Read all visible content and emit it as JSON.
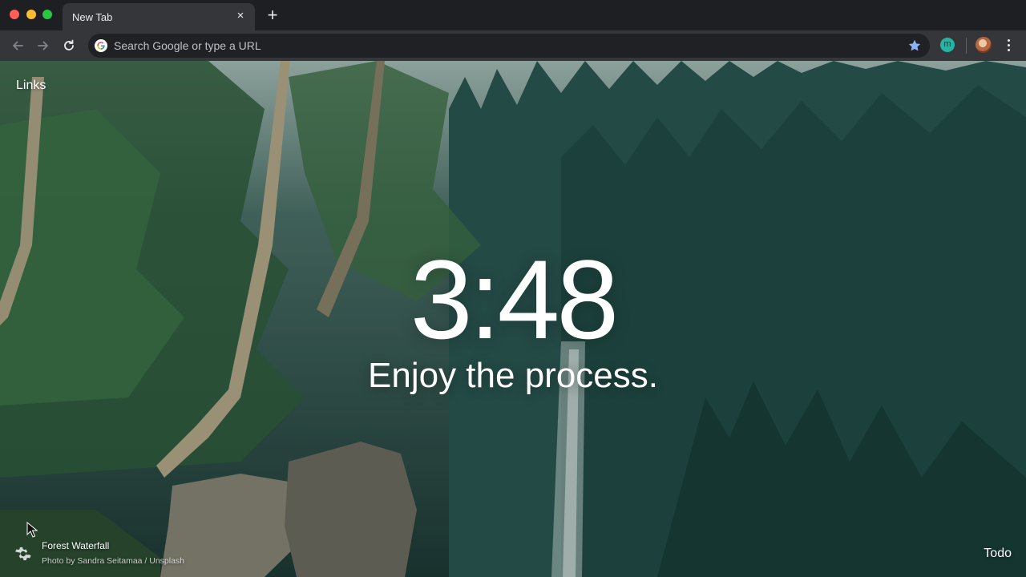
{
  "browser": {
    "tab": {
      "title": "New Tab",
      "close_glyph": "×"
    },
    "new_tab_glyph": "+",
    "omnibox": {
      "placeholder": "Search Google or type a URL"
    },
    "icons": {
      "back": "back-arrow-icon",
      "forward": "forward-arrow-icon",
      "reload": "reload-icon",
      "google": "google-g-icon",
      "bookmark": "bookmark-star-icon",
      "extension": "extension-icon",
      "profile": "profile-avatar",
      "menu": "kebab-menu-icon"
    },
    "extension_letter": "m",
    "colors": {
      "bookmark_star": "#8ab4f8",
      "extension": "#26b3a5"
    }
  },
  "dashboard": {
    "links_label": "Links",
    "time": "3:48",
    "mantra": "Enjoy the process.",
    "photo": {
      "title": "Forest Waterfall",
      "credit": "Photo by Sandra Seitamaa / Unsplash"
    },
    "todo_label": "Todo"
  }
}
